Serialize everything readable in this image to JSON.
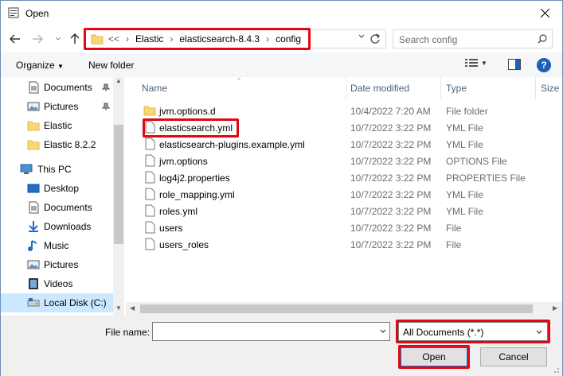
{
  "window": {
    "title": "Open"
  },
  "address": {
    "overflow": "<<",
    "crumbs": [
      "Elastic",
      "elasticsearch-8.4.3",
      "config"
    ]
  },
  "search": {
    "placeholder": "Search config"
  },
  "toolbar": {
    "organize": "Organize",
    "new_folder": "New folder"
  },
  "sidebar": {
    "items": [
      {
        "label": "Documents",
        "icon": "documents-icon",
        "pinned": true
      },
      {
        "label": "Pictures",
        "icon": "pictures-icon",
        "pinned": true
      },
      {
        "label": "Elastic",
        "icon": "folder-icon",
        "pinned": false
      },
      {
        "label": "Elastic 8.2.2",
        "icon": "folder-icon",
        "pinned": false
      },
      {
        "label": "This PC",
        "icon": "computer-icon",
        "pinned": false
      },
      {
        "label": "Desktop",
        "icon": "desktop-icon",
        "pinned": false
      },
      {
        "label": "Documents",
        "icon": "documents-icon",
        "pinned": false
      },
      {
        "label": "Downloads",
        "icon": "downloads-icon",
        "pinned": false
      },
      {
        "label": "Music",
        "icon": "music-icon",
        "pinned": false
      },
      {
        "label": "Pictures",
        "icon": "pictures-icon",
        "pinned": false
      },
      {
        "label": "Videos",
        "icon": "videos-icon",
        "pinned": false
      },
      {
        "label": "Local Disk (C:)",
        "icon": "disk-icon",
        "pinned": false
      }
    ]
  },
  "columns": {
    "name": "Name",
    "date": "Date modified",
    "type": "Type",
    "size": "Size"
  },
  "files": [
    {
      "name": "jvm.options.d",
      "date": "10/4/2022 7:20 AM",
      "type": "File folder",
      "icon": "folder-icon"
    },
    {
      "name": "elasticsearch.yml",
      "date": "10/7/2022 3:22 PM",
      "type": "YML File",
      "icon": "file-icon"
    },
    {
      "name": "elasticsearch-plugins.example.yml",
      "date": "10/7/2022 3:22 PM",
      "type": "YML File",
      "icon": "file-icon"
    },
    {
      "name": "jvm.options",
      "date": "10/7/2022 3:22 PM",
      "type": "OPTIONS File",
      "icon": "file-icon"
    },
    {
      "name": "log4j2.properties",
      "date": "10/7/2022 3:22 PM",
      "type": "PROPERTIES File",
      "icon": "file-icon"
    },
    {
      "name": "role_mapping.yml",
      "date": "10/7/2022 3:22 PM",
      "type": "YML File",
      "icon": "file-icon"
    },
    {
      "name": "roles.yml",
      "date": "10/7/2022 3:22 PM",
      "type": "YML File",
      "icon": "file-icon"
    },
    {
      "name": "users",
      "date": "10/7/2022 3:22 PM",
      "type": "File",
      "icon": "file-icon"
    },
    {
      "name": "users_roles",
      "date": "10/7/2022 3:22 PM",
      "type": "File",
      "icon": "file-icon"
    }
  ],
  "footer": {
    "file_name_label": "File name:",
    "file_name_value": "",
    "file_type": "All Documents (*.*)",
    "open": "Open",
    "cancel": "Cancel"
  },
  "colors": {
    "highlight": "#e30613",
    "accent": "#0078d7",
    "selection": "#cce8ff"
  }
}
